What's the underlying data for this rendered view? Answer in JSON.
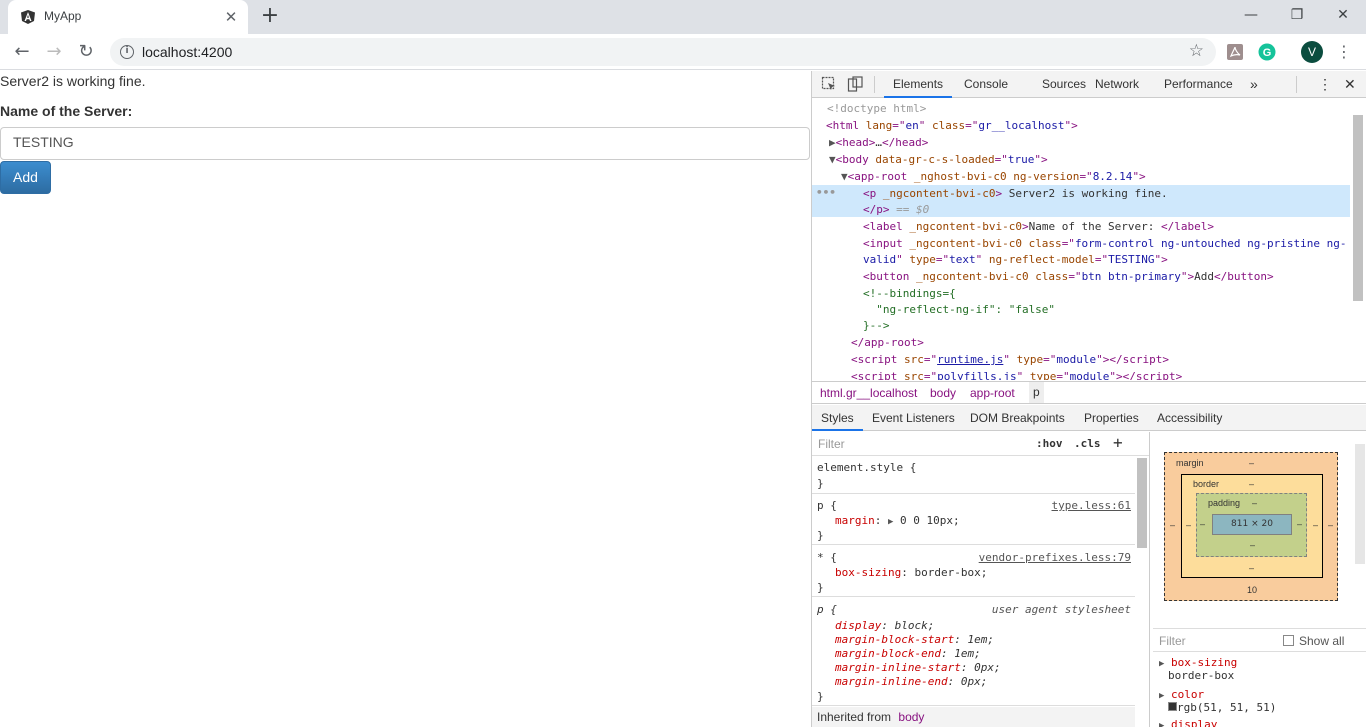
{
  "browser": {
    "tab_title": "MyApp",
    "url": "localhost:4200",
    "avatar_letter": "V"
  },
  "page": {
    "message": "Server2 is working fine.",
    "label": "Name of the Server:",
    "input_value": "TESTING",
    "button_label": "Add"
  },
  "devtools": {
    "tabs": [
      "Elements",
      "Console",
      "Sources",
      "Network",
      "Performance"
    ],
    "more_tabs": "»",
    "breadcrumb": [
      "html.gr__localhost",
      "body",
      "app-root",
      "p"
    ],
    "sub_tabs": [
      "Styles",
      "Event Listeners",
      "DOM Breakpoints",
      "Properties",
      "Accessibility"
    ],
    "styles_filter_placeholder": "Filter",
    "hov": ":hov",
    "cls": ".cls",
    "inherited_from": "Inherited from",
    "inherited_body": "body",
    "rules": {
      "element_style": "element.style {",
      "p_selector": "p {",
      "p_source": "type.less:61",
      "p_margin_prop": "margin",
      "p_margin_value": "0 0 10px;",
      "star_selector": "* {",
      "star_source": "vendor-prefixes.less:79",
      "box_sizing_prop": "box-sizing",
      "box_sizing_value": "border-box;",
      "ua_selector": "p {",
      "ua_source": "user agent stylesheet",
      "ua_props": [
        {
          "prop": "display",
          "value": "block;"
        },
        {
          "prop": "margin-block-start",
          "value": "1em;"
        },
        {
          "prop": "margin-block-end",
          "value": "1em;"
        },
        {
          "prop": "margin-inline-start",
          "value": "0px;"
        },
        {
          "prop": "margin-inline-end",
          "value": "0px;"
        }
      ],
      "close_brace": "}"
    },
    "box_model": {
      "margin_label": "margin",
      "border_label": "border",
      "padding_label": "padding",
      "dash": "–",
      "content_size": "811 × 20",
      "margin_bottom": "10"
    },
    "computed": {
      "filter_placeholder": "Filter",
      "show_all": "Show all",
      "props": [
        {
          "name": "box-sizing",
          "value": "border-box"
        },
        {
          "name": "color",
          "value": "rgb(51, 51, 51)"
        },
        {
          "name": "display",
          "value": ""
        }
      ]
    },
    "dom": {
      "doctype": "<!doctype html>",
      "html_open": "<html lang=\"en\" class=\"gr__localhost\">",
      "head": "<head>…</head>",
      "body_open": "<body data-gr-c-s-loaded=\"true\">",
      "approot_open": "<app-root _nghost-bvi-c0 ng-version=\"8.2.14\">",
      "p_line": "Server2 is working fine.",
      "p_close": "</p> == $0",
      "label_line": "Name of the Server: ",
      "input_line1": "<input _ngcontent-bvi-c0 class=\"form-control ng-untouched ng-pristine ng-",
      "input_line2": "valid\" type=\"text\" ng-reflect-model=\"TESTING\">",
      "button_text": "Add",
      "comment1": "<!--bindings={",
      "comment2": "  \"ng-reflect-ng-if\": \"false\"",
      "comment3": "}-->",
      "approot_close": "</app-root>",
      "script1": "runtime.js",
      "script2": "polyfills.js"
    }
  }
}
